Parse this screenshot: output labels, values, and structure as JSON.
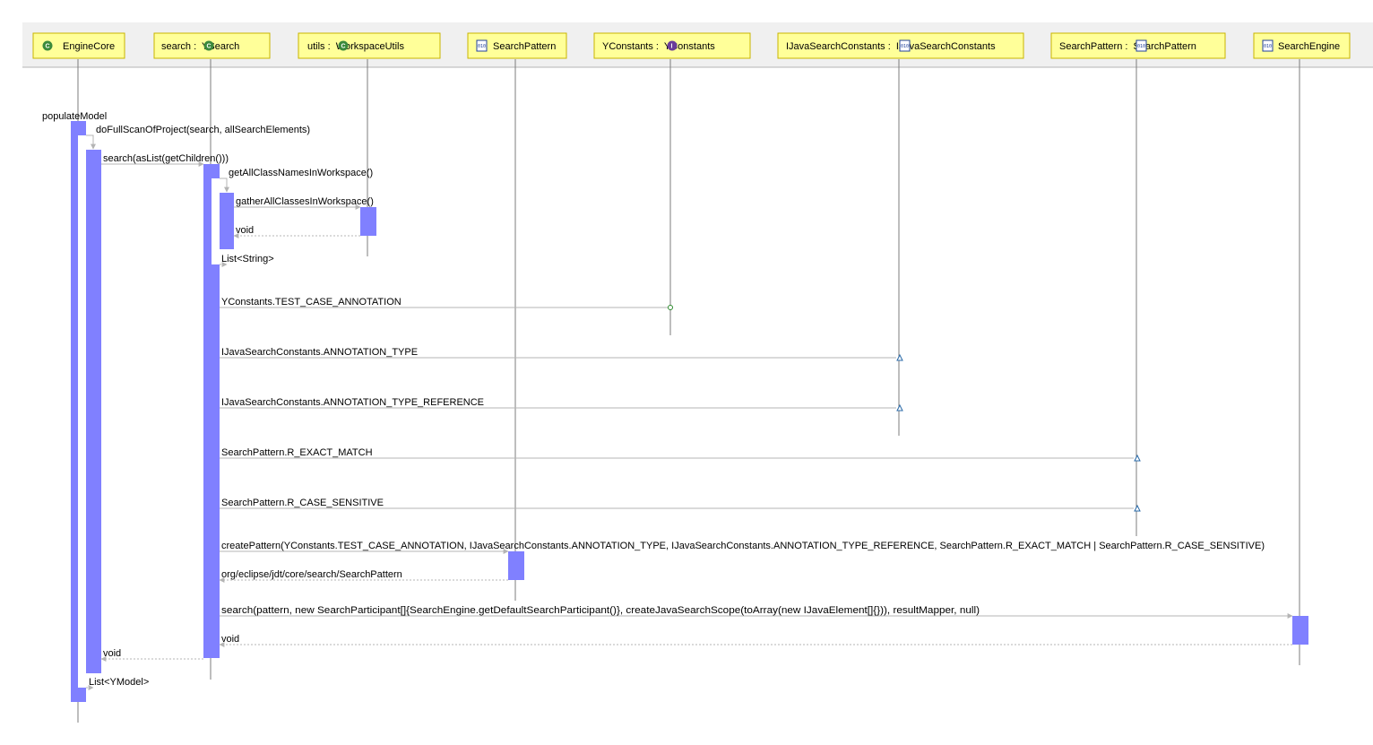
{
  "participants": [
    {
      "id": "p0",
      "label": "EngineCore",
      "icon": "class-icon"
    },
    {
      "id": "p1",
      "label": "search :  YSearch",
      "icon": "class-icon"
    },
    {
      "id": "p2",
      "label": "utils :  WorkspaceUtils",
      "icon": "class-icon"
    },
    {
      "id": "p3",
      "label": "SearchPattern",
      "icon": "binary-class-icon"
    },
    {
      "id": "p4",
      "label": "YConstants :  YConstants",
      "icon": "interface-icon"
    },
    {
      "id": "p5",
      "label": "IJavaSearchConstants :  IJavaSearchConstants",
      "icon": "binary-class-icon"
    },
    {
      "id": "p6",
      "label": "SearchPattern :  SearchPattern",
      "icon": "binary-class-icon"
    },
    {
      "id": "p7",
      "label": "SearchEngine",
      "icon": "binary-class-icon"
    }
  ],
  "colors": {
    "activation": "#8080ff",
    "participant_fill": "#ffff99",
    "participant_border": "#c8b400",
    "header_band": "#f0f0f0",
    "message_line": "#b4b4b4",
    "class_icon": "#3c8a3c",
    "interface_icon": "#6a3c9a",
    "field_marker_green": "#2a8a2a",
    "field_marker_blue": "#2a6aa8"
  },
  "messages": [
    {
      "id": "m0",
      "label": "populateModel",
      "kind": "entry"
    },
    {
      "id": "m1",
      "label": "doFullScanOfProject(search, allSearchElements)",
      "kind": "self"
    },
    {
      "id": "m2",
      "label": "search(asList(getChildren()))",
      "kind": "call"
    },
    {
      "id": "m3",
      "label": "getAllClassNamesInWorkspace()",
      "kind": "self"
    },
    {
      "id": "m4",
      "label": "gatherAllClassesInWorkspace()",
      "kind": "call"
    },
    {
      "id": "m5",
      "label": "void",
      "kind": "return"
    },
    {
      "id": "m6",
      "label": "List<String>",
      "kind": "return"
    },
    {
      "id": "m7",
      "label": "YConstants.TEST_CASE_ANNOTATION",
      "kind": "field"
    },
    {
      "id": "m8",
      "label": "IJavaSearchConstants.ANNOTATION_TYPE",
      "kind": "field"
    },
    {
      "id": "m9",
      "label": "IJavaSearchConstants.ANNOTATION_TYPE_REFERENCE",
      "kind": "field"
    },
    {
      "id": "m10",
      "label": "SearchPattern.R_EXACT_MATCH",
      "kind": "field"
    },
    {
      "id": "m11",
      "label": "SearchPattern.R_CASE_SENSITIVE",
      "kind": "field"
    },
    {
      "id": "m12",
      "label": "createPattern(YConstants.TEST_CASE_ANNOTATION, IJavaSearchConstants.ANNOTATION_TYPE, IJavaSearchConstants.ANNOTATION_TYPE_REFERENCE, SearchPattern.R_EXACT_MATCH | SearchPattern.R_CASE_SENSITIVE)",
      "kind": "call"
    },
    {
      "id": "m13",
      "label": "org/eclipse/jdt/core/search/SearchPattern",
      "kind": "return"
    },
    {
      "id": "m14",
      "label": "search(pattern, new SearchParticipant[]{SearchEngine.getDefaultSearchParticipant()}, createJavaSearchScope(toArray(new IJavaElement[]{})), resultMapper, null)",
      "kind": "call"
    },
    {
      "id": "m15",
      "label": "void",
      "kind": "return"
    },
    {
      "id": "m16",
      "label": "void",
      "kind": "return"
    },
    {
      "id": "m17",
      "label": "List<YModel>",
      "kind": "return"
    }
  ]
}
